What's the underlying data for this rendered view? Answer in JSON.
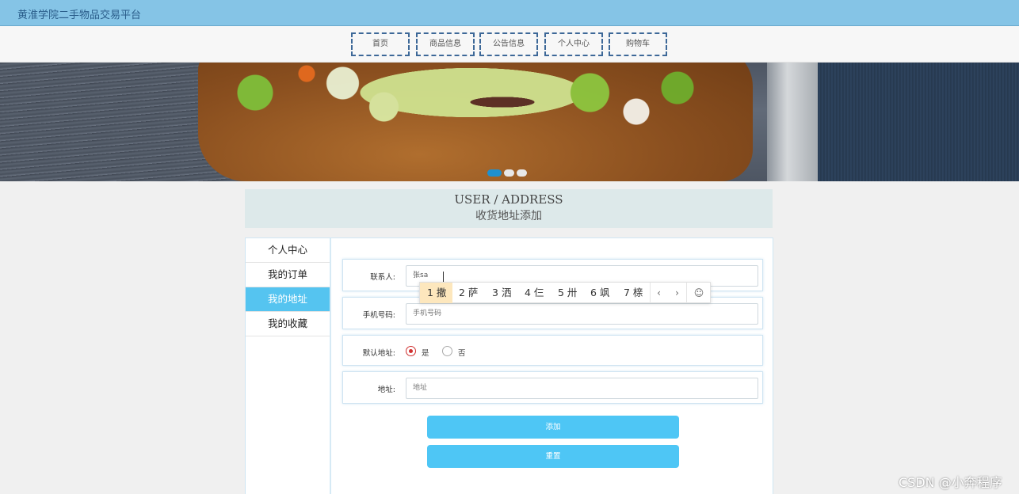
{
  "site": {
    "title": "黄淮学院二手物品交易平台"
  },
  "nav": {
    "items": [
      "首页",
      "商品信息",
      "公告信息",
      "个人中心",
      "购物车"
    ]
  },
  "banner": {
    "dots": 3,
    "active_dot": 0
  },
  "heading": {
    "en": "USER / ADDRESS",
    "cn": "收货地址添加"
  },
  "sidebar": {
    "items": [
      "个人中心",
      "我的订单",
      "我的地址",
      "我的收藏"
    ],
    "active_index": 2
  },
  "form": {
    "contact": {
      "label": "联系人:",
      "value": "张sa"
    },
    "phone": {
      "label": "手机号码:",
      "placeholder": "手机号码"
    },
    "default": {
      "label": "默认地址:",
      "options": [
        "是",
        "否"
      ],
      "selected": "是"
    },
    "address": {
      "label": "地址:",
      "placeholder": "地址"
    },
    "add_button": "添加",
    "reset_button": "重置"
  },
  "ime": {
    "candidates": [
      "1 撒",
      "2 萨",
      "3 洒",
      "4 仨",
      "5 卅",
      "6 飒",
      "7 榇"
    ],
    "prev": "‹",
    "next": "›",
    "emoji": "☺"
  },
  "watermark": "CSDN @小奔程序"
}
